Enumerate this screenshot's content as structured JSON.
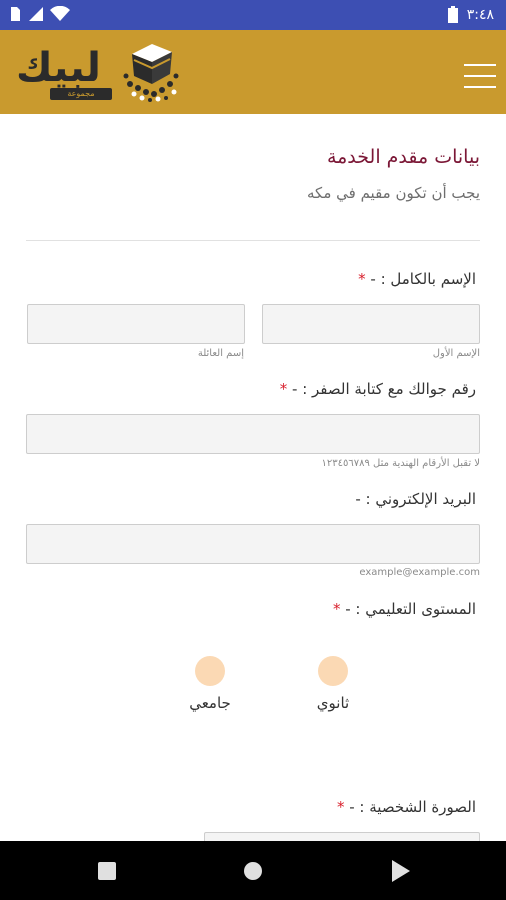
{
  "status_bar": {
    "time": "٣:٤٨",
    "icons": [
      "sim-icon",
      "signal-icon",
      "wifi-icon",
      "battery-icon"
    ]
  },
  "header": {
    "logo_text": "لبيك",
    "logo_subtext": "مجموعة",
    "menu_icon": "hamburger-menu-icon",
    "background_color": "#c99a2e"
  },
  "form": {
    "title": "بيانات مقدم الخدمة",
    "subtitle": "يجب أن تكون مقيم في مكه",
    "required_mark": "*",
    "full_name": {
      "label": "الإسم بالكامل : -",
      "first_name_hint": "الإسم الأول",
      "last_name_hint": "إسم العائلة",
      "first_name_value": "",
      "last_name_value": ""
    },
    "mobile": {
      "label": "رقم جوالك مع كتابة الصفر : -",
      "hint": "لا تقبل الأرقام الهندية مثل ١٢٣٤٥٦٧٨٩",
      "value": ""
    },
    "email": {
      "label": "البريد الإلكتروني : -",
      "hint": "example@example.com",
      "value": ""
    },
    "education": {
      "label": "المستوى التعليمي : -",
      "options": [
        "ثانوي",
        "جامعي"
      ]
    },
    "photo": {
      "label": "الصورة الشخصية : -"
    }
  },
  "colors": {
    "title": "#7b1736",
    "required": "#d8202d",
    "radio": "#fbd9b4",
    "status_bar": "#3d4fb3"
  },
  "nav_bar": {
    "icons": [
      "recent-apps-icon",
      "home-icon",
      "back-icon"
    ]
  }
}
